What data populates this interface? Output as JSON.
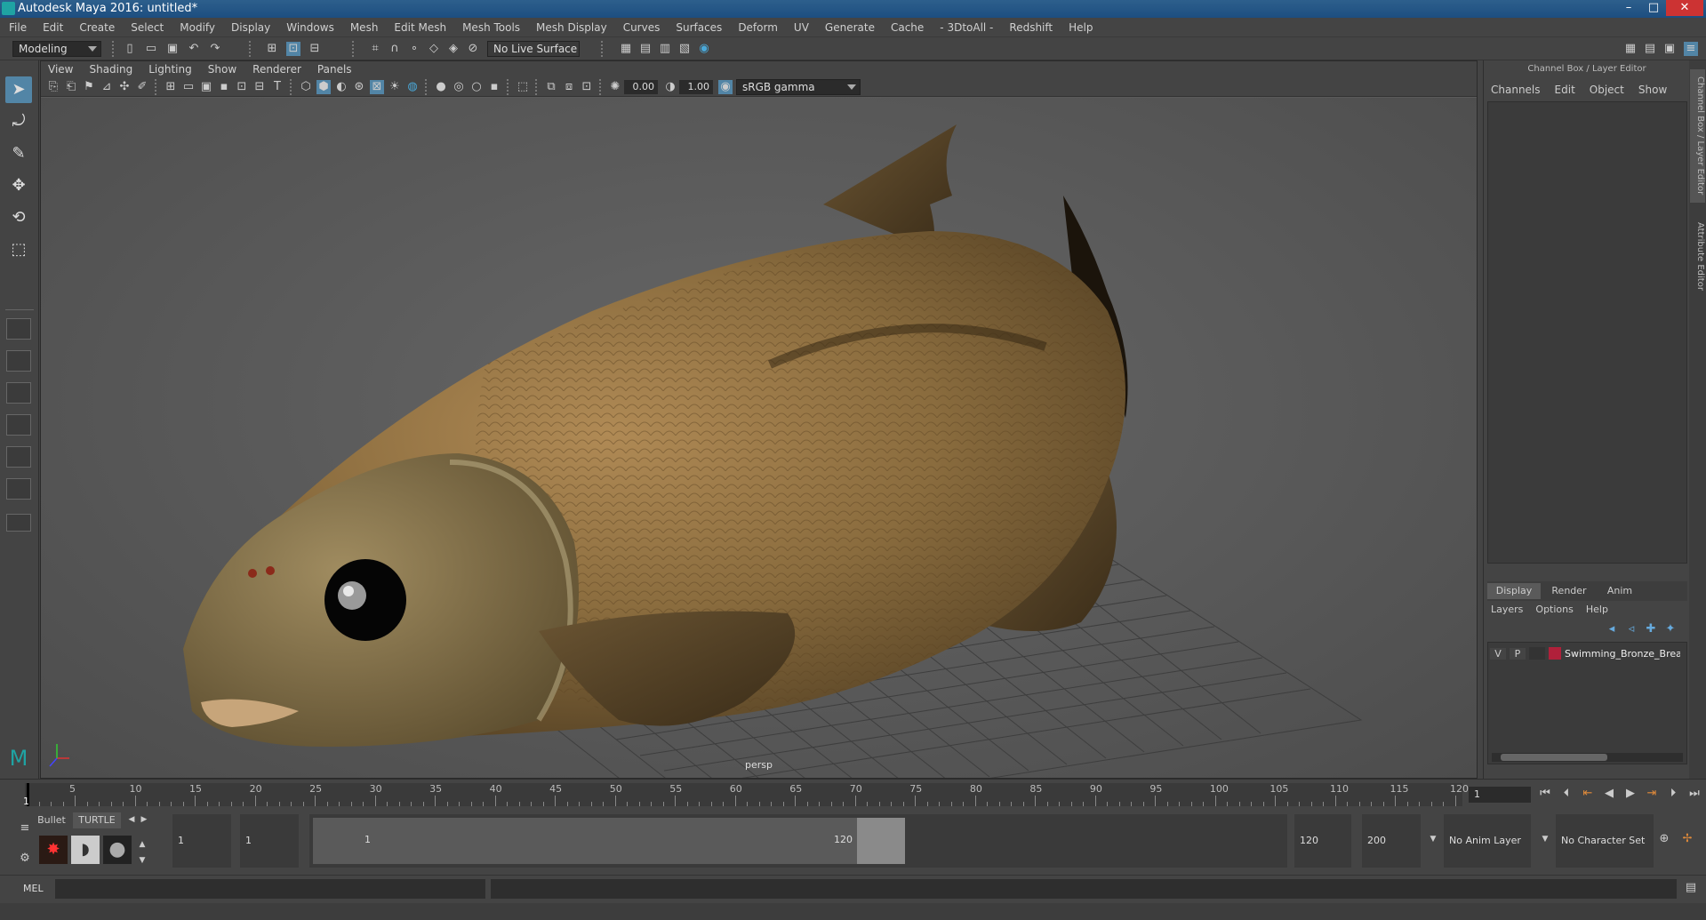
{
  "window": {
    "title": "Autodesk Maya 2016: untitled*",
    "minimize": "–",
    "maximize": "□",
    "close": "✕"
  },
  "menubar": [
    "File",
    "Edit",
    "Create",
    "Select",
    "Modify",
    "Display",
    "Windows",
    "Mesh",
    "Edit Mesh",
    "Mesh Tools",
    "Mesh Display",
    "Curves",
    "Surfaces",
    "Deform",
    "UV",
    "Generate",
    "Cache",
    "- 3DtoAll -",
    "Redshift",
    "Help"
  ],
  "statusline": {
    "mode": "Modeling",
    "live_surface": "No Live Surface"
  },
  "viewport": {
    "menus": [
      "View",
      "Shading",
      "Lighting",
      "Show",
      "Renderer",
      "Panels"
    ],
    "exposure": "0.00",
    "gamma": "1.00",
    "color_space": "sRGB gamma",
    "camera_label": "persp"
  },
  "channel_box": {
    "title": "Channel Box / Layer Editor",
    "menus": [
      "Channels",
      "Edit",
      "Object",
      "Show"
    ]
  },
  "layer_editor": {
    "tabs": [
      "Display",
      "Render",
      "Anim"
    ],
    "active_tab": "Display",
    "menus": [
      "Layers",
      "Options",
      "Help"
    ],
    "layers": [
      {
        "v": "V",
        "p": "P",
        "color": "#b0203a",
        "name": "Swimming_Bronze_Brear"
      }
    ]
  },
  "side_tabs": [
    "Channel Box / Layer Editor",
    "Attribute Editor"
  ],
  "timeline": {
    "ticks": [
      5,
      10,
      15,
      20,
      25,
      30,
      35,
      40,
      45,
      50,
      55,
      60,
      65,
      70,
      75,
      80,
      85,
      90,
      95,
      100,
      105,
      110,
      115,
      120
    ],
    "start_label": "1",
    "current_frame": "1"
  },
  "range": {
    "shelf_tabs": [
      "Bullet",
      "TURTLE"
    ],
    "start_frame": "1",
    "playback_start": "1",
    "slider_start": "1",
    "slider_end": "120",
    "playback_end": "120",
    "end_frame": "200",
    "anim_layer": "No Anim Layer",
    "character_set": "No Character Set"
  },
  "cmdline": {
    "label": "MEL"
  },
  "colors": {
    "accent": "#5285a6",
    "titlebar": "#1d4e80",
    "layer_red": "#b0203a"
  }
}
